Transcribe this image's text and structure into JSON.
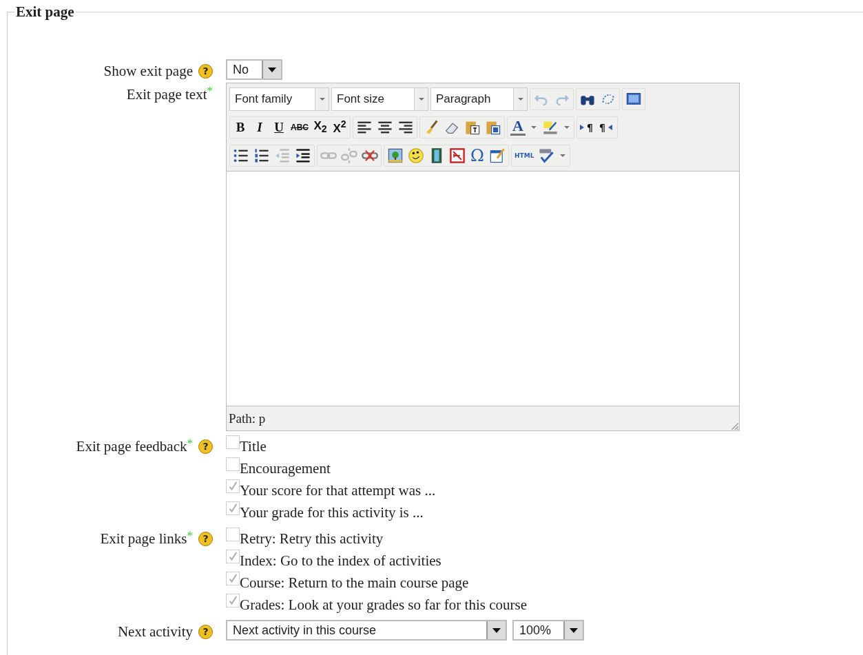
{
  "legend": "Exit page",
  "show_exit": {
    "label": "Show exit page",
    "help": "?",
    "value": "No"
  },
  "exit_text": {
    "label": "Exit page text",
    "marker": "*",
    "toolbar": {
      "font_family": "Font family",
      "font_size": "Font size",
      "format": "Paragraph",
      "undo": {
        "disabled": true
      },
      "redo": {
        "disabled": true
      },
      "bold": "B",
      "italic": "I",
      "underline": "U",
      "strikethrough": "ABC",
      "subscript": "X$_{2}$",
      "superscript": "X$^{2}$",
      "font_color": "A",
      "ltr": "¶",
      "rtl": "¶",
      "link": {
        "disabled": true
      },
      "unlink": {
        "disabled": true
      },
      "omega": "Ω",
      "html": "HTML"
    },
    "status": "Path: p"
  },
  "feedback": {
    "label": "Exit page feedback",
    "marker": "*",
    "help": "?",
    "options": [
      {
        "label": "Title",
        "checked": false
      },
      {
        "label": "Encouragement",
        "checked": false
      },
      {
        "label": "Your score for that attempt was ...",
        "checked": true
      },
      {
        "label": "Your grade for this activity is ...",
        "checked": true
      }
    ]
  },
  "links": {
    "label": "Exit page links",
    "marker": "*",
    "help": "?",
    "options": [
      {
        "label": "Retry: Retry this activity",
        "checked": false
      },
      {
        "label": "Index: Go to the index of activities",
        "checked": true
      },
      {
        "label": "Course: Return to the main course page",
        "checked": true
      },
      {
        "label": "Grades: Look at your grades so far for this course",
        "checked": true
      }
    ]
  },
  "next_activity": {
    "label": "Next activity",
    "help": "?",
    "value": "Next activity in this course",
    "percent": "100%"
  }
}
